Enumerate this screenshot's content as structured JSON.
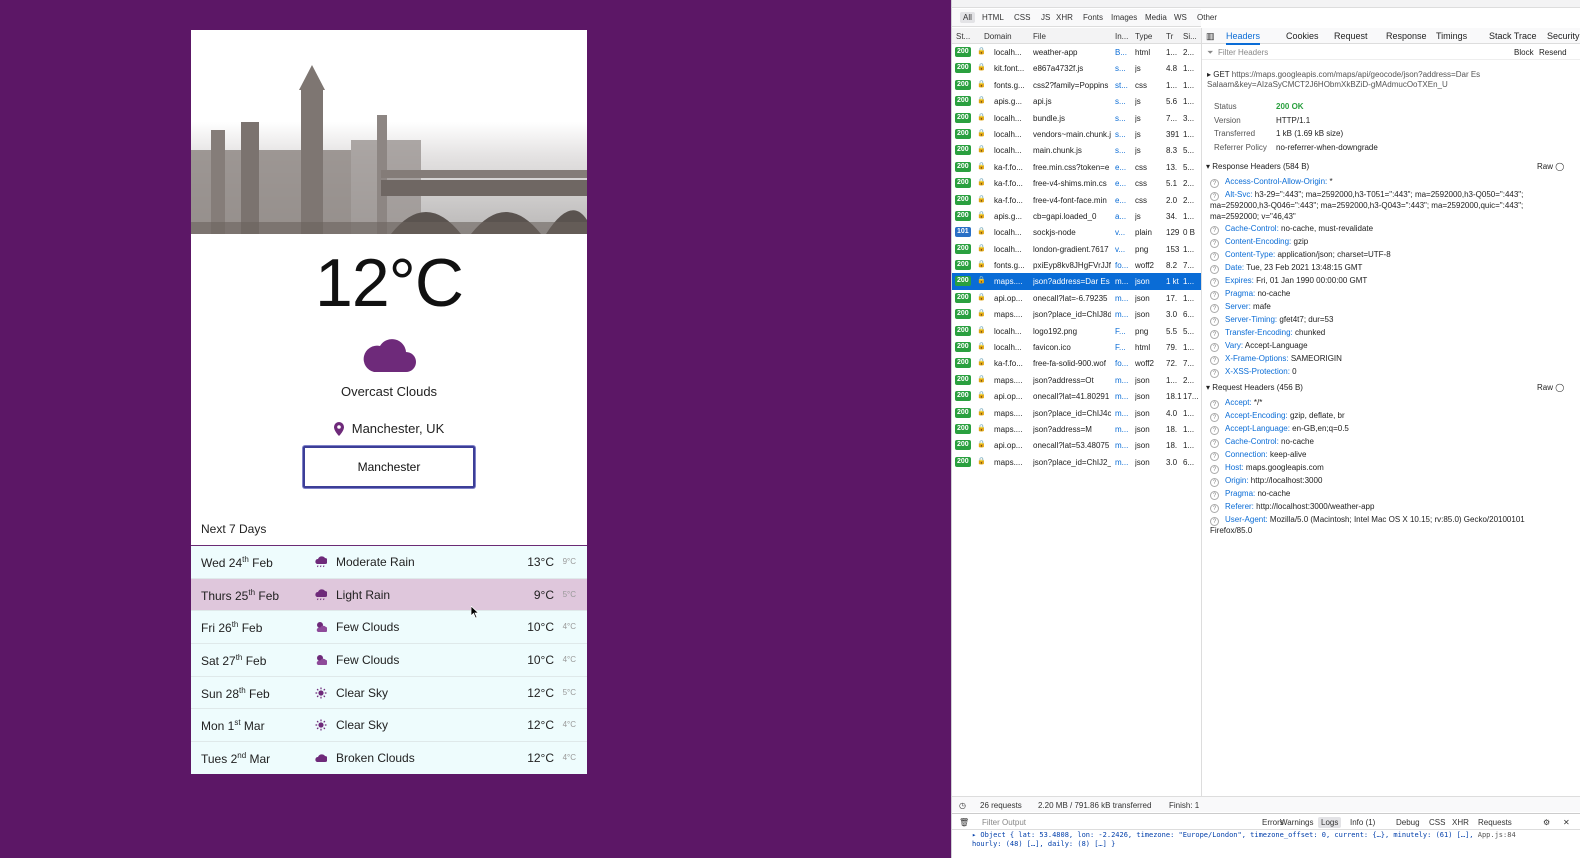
{
  "colors": {
    "background": "#5c1766",
    "accent_purple": "#6b2b75",
    "devtools_blue": "#0a6cd6",
    "status_green": "#2aa03f"
  },
  "weather": {
    "temperature": "12°C",
    "condition": "Overcast Clouds",
    "location": "Manchester, UK",
    "search_value": "Manchester",
    "next_title": "Next 7 Days",
    "days": [
      {
        "dow": "Wed 24",
        "sup": "th",
        "month": " Feb",
        "icon": "rain-cloud-icon",
        "desc": "Moderate Rain",
        "hi": "13°C",
        "lo": "9°C"
      },
      {
        "dow": "Thurs 25",
        "sup": "th",
        "month": " Feb",
        "icon": "rain-cloud-icon",
        "desc": "Light Rain",
        "hi": "9°C",
        "lo": "5°C"
      },
      {
        "dow": "Fri 26",
        "sup": "th",
        "month": " Feb",
        "icon": "cloud-sun-icon",
        "desc": "Few Clouds",
        "hi": "10°C",
        "lo": "4°C"
      },
      {
        "dow": "Sat 27",
        "sup": "th",
        "month": " Feb",
        "icon": "cloud-sun-icon",
        "desc": "Few Clouds",
        "hi": "10°C",
        "lo": "4°C"
      },
      {
        "dow": "Sun 28",
        "sup": "th",
        "month": " Feb",
        "icon": "sun-icon",
        "desc": "Clear Sky",
        "hi": "12°C",
        "lo": "5°C"
      },
      {
        "dow": "Mon 1",
        "sup": "st",
        "month": " Mar",
        "icon": "sun-icon",
        "desc": "Clear Sky",
        "hi": "12°C",
        "lo": "4°C"
      },
      {
        "dow": "Tues 2",
        "sup": "nd",
        "month": " Mar",
        "icon": "cloud-icon",
        "desc": "Broken Clouds",
        "hi": "12°C",
        "lo": "4°C"
      }
    ]
  },
  "devtools": {
    "filter_types": [
      "All",
      "HTML",
      "CSS",
      "JS",
      "XHR",
      "Fonts",
      "Images",
      "Media",
      "WS",
      "Other"
    ],
    "columns": [
      "St...",
      "Domain",
      "File",
      "In...",
      "Type",
      "Tr",
      "Si..."
    ],
    "requests": [
      {
        "status": "200",
        "domain": "localh...",
        "file": "weather-app",
        "init": "B...",
        "type": "html",
        "tr": "1...",
        "size": "2..."
      },
      {
        "status": "200",
        "domain": "kit.font...",
        "file": "e867a4732f.js",
        "init": "s...",
        "type": "js",
        "tr": "4.8",
        "size": "1..."
      },
      {
        "status": "200",
        "domain": "fonts.g...",
        "file": "css2?family=Poppins",
        "init": "st...",
        "type": "css",
        "tr": "1...",
        "size": "1..."
      },
      {
        "status": "200",
        "domain": "apis.g...",
        "file": "api.js",
        "init": "s...",
        "type": "js",
        "tr": "5.6",
        "size": "1..."
      },
      {
        "status": "200",
        "domain": "localh...",
        "file": "bundle.js",
        "init": "s...",
        "type": "js",
        "tr": "7...",
        "size": "3..."
      },
      {
        "status": "200",
        "domain": "localh...",
        "file": "vendors~main.chunk.j",
        "init": "s...",
        "type": "js",
        "tr": "391",
        "size": "1..."
      },
      {
        "status": "200",
        "domain": "localh...",
        "file": "main.chunk.js",
        "init": "s...",
        "type": "js",
        "tr": "8.3",
        "size": "5..."
      },
      {
        "status": "200",
        "domain": "ka-f.fo...",
        "file": "free.min.css?token=e",
        "init": "e...",
        "type": "css",
        "tr": "13.",
        "size": "5..."
      },
      {
        "status": "200",
        "domain": "ka-f.fo...",
        "file": "free-v4-shims.min.cs",
        "init": "e...",
        "type": "css",
        "tr": "5.1",
        "size": "2..."
      },
      {
        "status": "200",
        "domain": "ka-f.fo...",
        "file": "free-v4-font-face.min",
        "init": "e...",
        "type": "css",
        "tr": "2.0",
        "size": "2..."
      },
      {
        "status": "200",
        "domain": "apis.g...",
        "file": "cb=gapi.loaded_0",
        "init": "a...",
        "type": "js",
        "tr": "34.",
        "size": "1..."
      },
      {
        "status": "101",
        "domain": "localh...",
        "file": "sockjs-node",
        "init": "v...",
        "type": "plain",
        "tr": "129",
        "size": "0 B"
      },
      {
        "status": "200",
        "domain": "localh...",
        "file": "london-gradient.7617",
        "init": "v...",
        "type": "png",
        "tr": "153",
        "size": "1..."
      },
      {
        "status": "200",
        "domain": "fonts.g...",
        "file": "pxiEyp8kv8JHgFVrJJf",
        "init": "fo...",
        "type": "woff2",
        "tr": "8.2",
        "size": "7..."
      },
      {
        "status": "200",
        "domain": "maps....",
        "file": "json?address=Dar Es",
        "init": "m...",
        "type": "json",
        "tr": "1 kt",
        "size": "1..."
      },
      {
        "status": "200",
        "domain": "api.op...",
        "file": "onecall?lat=-6.79235",
        "init": "m...",
        "type": "json",
        "tr": "17.",
        "size": "1..."
      },
      {
        "status": "200",
        "domain": "maps....",
        "file": "json?place_id=ChIJ8d",
        "init": "m...",
        "type": "json",
        "tr": "3.0",
        "size": "6..."
      },
      {
        "status": "200",
        "domain": "localh...",
        "file": "logo192.png",
        "init": "F...",
        "type": "png",
        "tr": "5.5",
        "size": "5..."
      },
      {
        "status": "200",
        "domain": "localh...",
        "file": "favicon.ico",
        "init": "F...",
        "type": "html",
        "tr": "79.",
        "size": "1..."
      },
      {
        "status": "200",
        "domain": "ka-f.fo...",
        "file": "free-fa-solid-900.wof",
        "init": "fo...",
        "type": "woff2",
        "tr": "72.",
        "size": "7..."
      },
      {
        "status": "200",
        "domain": "maps....",
        "file": "json?address=Ot",
        "init": "m...",
        "type": "json",
        "tr": "1...",
        "size": "2..."
      },
      {
        "status": "200",
        "domain": "api.op...",
        "file": "onecall?lat=41.80291",
        "init": "m...",
        "type": "json",
        "tr": "18.1",
        "size": "17..."
      },
      {
        "status": "200",
        "domain": "maps....",
        "file": "json?place_id=ChIJ4c",
        "init": "m...",
        "type": "json",
        "tr": "4.0",
        "size": "1..."
      },
      {
        "status": "200",
        "domain": "maps....",
        "file": "json?address=M",
        "init": "m...",
        "type": "json",
        "tr": "18.",
        "size": "1..."
      },
      {
        "status": "200",
        "domain": "api.op...",
        "file": "onecall?lat=53.48075",
        "init": "m...",
        "type": "json",
        "tr": "18.",
        "size": "1..."
      },
      {
        "status": "200",
        "domain": "maps....",
        "file": "json?place_id=ChIJ2_",
        "init": "m...",
        "type": "json",
        "tr": "3.0",
        "size": "6..."
      }
    ],
    "detail_tabs": [
      "Headers",
      "Cookies",
      "Request",
      "Response",
      "Timings",
      "Stack Trace",
      "Security"
    ],
    "filter_headers_placeholder": "Filter Headers",
    "block_label": "Block",
    "resend_label": "Resend",
    "request_method": "GET",
    "request_url": "https://maps.googleapis.com/maps/api/geocode/json?address=Dar Es Salaam&key=AIzaSyCMCT2J6HObmXkBZiD-gMAdmucOoTXEn_U",
    "summary": [
      {
        "k": "Status",
        "v": "200 OK"
      },
      {
        "k": "Version",
        "v": "HTTP/1.1"
      },
      {
        "k": "Transferred",
        "v": "1 kB (1.69 kB size)"
      },
      {
        "k": "Referrer Policy",
        "v": "no-referrer-when-downgrade"
      }
    ],
    "response_title": "Response Headers (584 B)",
    "raw_label": "Raw",
    "response_headers": [
      {
        "k": "Access-Control-Allow-Origin:",
        "v": "*"
      },
      {
        "k": "Alt-Svc:",
        "v": "h3-29=\":443\"; ma=2592000,h3-T051=\":443\"; ma=2592000,h3-Q050=\":443\"; ma=2592000,h3-Q046=\":443\"; ma=2592000,h3-Q043=\":443\"; ma=2592000,quic=\":443\"; ma=2592000; v=\"46,43\""
      },
      {
        "k": "Cache-Control:",
        "v": "no-cache, must-revalidate"
      },
      {
        "k": "Content-Encoding:",
        "v": "gzip"
      },
      {
        "k": "Content-Type:",
        "v": "application/json; charset=UTF-8"
      },
      {
        "k": "Date:",
        "v": "Tue, 23 Feb 2021 13:48:15 GMT"
      },
      {
        "k": "Expires:",
        "v": "Fri, 01 Jan 1990 00:00:00 GMT"
      },
      {
        "k": "Pragma:",
        "v": "no-cache"
      },
      {
        "k": "Server:",
        "v": "mafe"
      },
      {
        "k": "Server-Timing:",
        "v": "gfet4t7; dur=53"
      },
      {
        "k": "Transfer-Encoding:",
        "v": "chunked"
      },
      {
        "k": "Vary:",
        "v": "Accept-Language"
      },
      {
        "k": "X-Frame-Options:",
        "v": "SAMEORIGIN"
      },
      {
        "k": "X-XSS-Protection:",
        "v": "0"
      }
    ],
    "request_title": "Request Headers (456 B)",
    "request_headers": [
      {
        "k": "Accept:",
        "v": "*/*"
      },
      {
        "k": "Accept-Encoding:",
        "v": "gzip, deflate, br"
      },
      {
        "k": "Accept-Language:",
        "v": "en-GB,en;q=0.5"
      },
      {
        "k": "Cache-Control:",
        "v": "no-cache"
      },
      {
        "k": "Connection:",
        "v": "keep-alive"
      },
      {
        "k": "Host:",
        "v": "maps.googleapis.com"
      },
      {
        "k": "Origin:",
        "v": "http://localhost:3000"
      },
      {
        "k": "Pragma:",
        "v": "no-cache"
      },
      {
        "k": "Referer:",
        "v": "http://localhost:3000/weather-app"
      },
      {
        "k": "User-Agent:",
        "v": "Mozilla/5.0 (Macintosh; Intel Mac OS X 10.15; rv:85.0) Gecko/20100101 Firefox/85.0"
      }
    ],
    "footer": {
      "requests": "26 requests",
      "transferred": "2.20 MB / 791.86 kB transferred",
      "finish": "Finish: 1"
    },
    "console": {
      "filter_placeholder": "Filter Output",
      "buttons": [
        "Errors",
        "Warnings",
        "Logs",
        "Info (1)",
        "Debug",
        "CSS",
        "XHR",
        "Requests"
      ],
      "line1": "▸ Object { lat: 53.4808, lon: -2.2426, timezone: \"Europe/London\", timezone_offset: 0, current: {…}, minutely: (61) […],",
      "line1_source": "App.js:84",
      "line2": "hourly: (48) […], daily: (8) […] }"
    }
  }
}
